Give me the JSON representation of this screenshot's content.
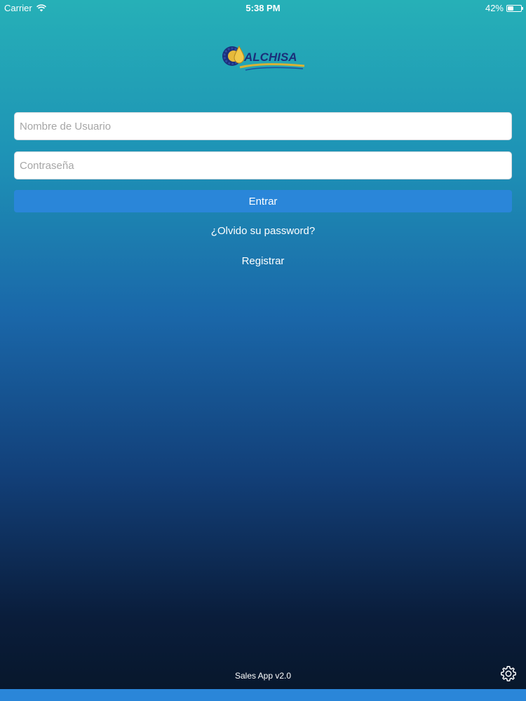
{
  "status_bar": {
    "carrier": "Carrier",
    "time": "5:38 PM",
    "battery_text": "42%",
    "battery_level": 0.42
  },
  "logo": {
    "text": "ALCHISA"
  },
  "login_form": {
    "username_placeholder": "Nombre de Usuario",
    "username_value": "",
    "password_placeholder": "Contraseña",
    "password_value": "",
    "submit_label": "Entrar",
    "forgot_label": "¿Olvido su password?",
    "register_label": "Registrar"
  },
  "footer": {
    "version": "Sales App v2.0",
    "settings_icon": "gear-icon"
  },
  "colors": {
    "accent": "#2a86d9",
    "background_top": "#26b0b7",
    "background_bottom": "#071629"
  }
}
